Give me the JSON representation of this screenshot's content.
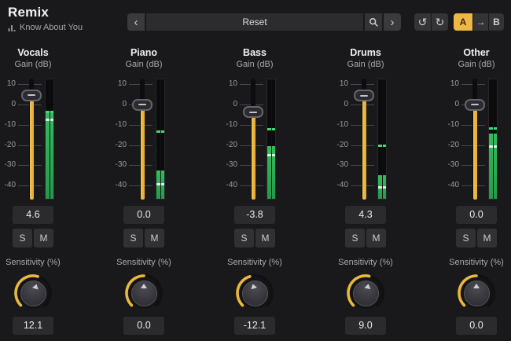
{
  "header": {
    "title": "Remix",
    "subtitle": "Know About You"
  },
  "toolbar": {
    "preset": {
      "prev": "‹",
      "name": "Reset",
      "next": "›"
    },
    "undo": "↺",
    "redo": "↻",
    "ab": {
      "a": "A",
      "arrow": "→",
      "b": "B",
      "active": "A"
    }
  },
  "labels": {
    "gain": "Gain (dB)",
    "sensitivity": "Sensitivity (%)",
    "solo": "S",
    "mute": "M"
  },
  "scale": {
    "ticks": [
      {
        "label": "10",
        "db": 10
      },
      {
        "label": "0",
        "db": 0
      },
      {
        "label": "-10",
        "db": -10
      },
      {
        "label": "-20",
        "db": -20
      },
      {
        "label": "-30",
        "db": -30
      },
      {
        "label": "-40",
        "db": -40
      }
    ]
  },
  "channels": [
    {
      "name": "Vocals",
      "gain_display": "4.6",
      "gain_db": 4.6,
      "sens_display": "12.1",
      "sens_value": 12.1,
      "meter": {
        "bar_top_db": -3.6,
        "hold_db": -3.2,
        "peak_db": -7.2
      }
    },
    {
      "name": "Piano",
      "gain_display": "0.0",
      "gain_db": 0.0,
      "sens_display": "0.0",
      "sens_value": 0.0,
      "meter": {
        "bar_top_db": -32.0,
        "hold_db": -13.0,
        "peak_db": -39.0
      }
    },
    {
      "name": "Bass",
      "gain_display": "-3.8",
      "gain_db": -3.8,
      "sens_display": "-12.1",
      "sens_value": -12.1,
      "meter": {
        "bar_top_db": -20.0,
        "hold_db": -11.8,
        "peak_db": -24.5
      }
    },
    {
      "name": "Drums",
      "gain_display": "4.3",
      "gain_db": 4.3,
      "sens_display": "9.0",
      "sens_value": 9.0,
      "meter": {
        "bar_top_db": -34.5,
        "hold_db": -19.8,
        "peak_db": -40.5
      }
    },
    {
      "name": "Other",
      "gain_display": "0.0",
      "gain_db": 0.0,
      "sens_display": "0.0",
      "sens_value": 0.0,
      "meter": {
        "bar_top_db": -13.8,
        "hold_db": -11.3,
        "peak_db": -20.5
      }
    }
  ],
  "colors": {
    "background": "#19191b",
    "accent_yellow": "#e9b83c",
    "meter_green": "#2aa853",
    "meter_hold_green": "#46d675",
    "ab_active": "#edb844"
  }
}
